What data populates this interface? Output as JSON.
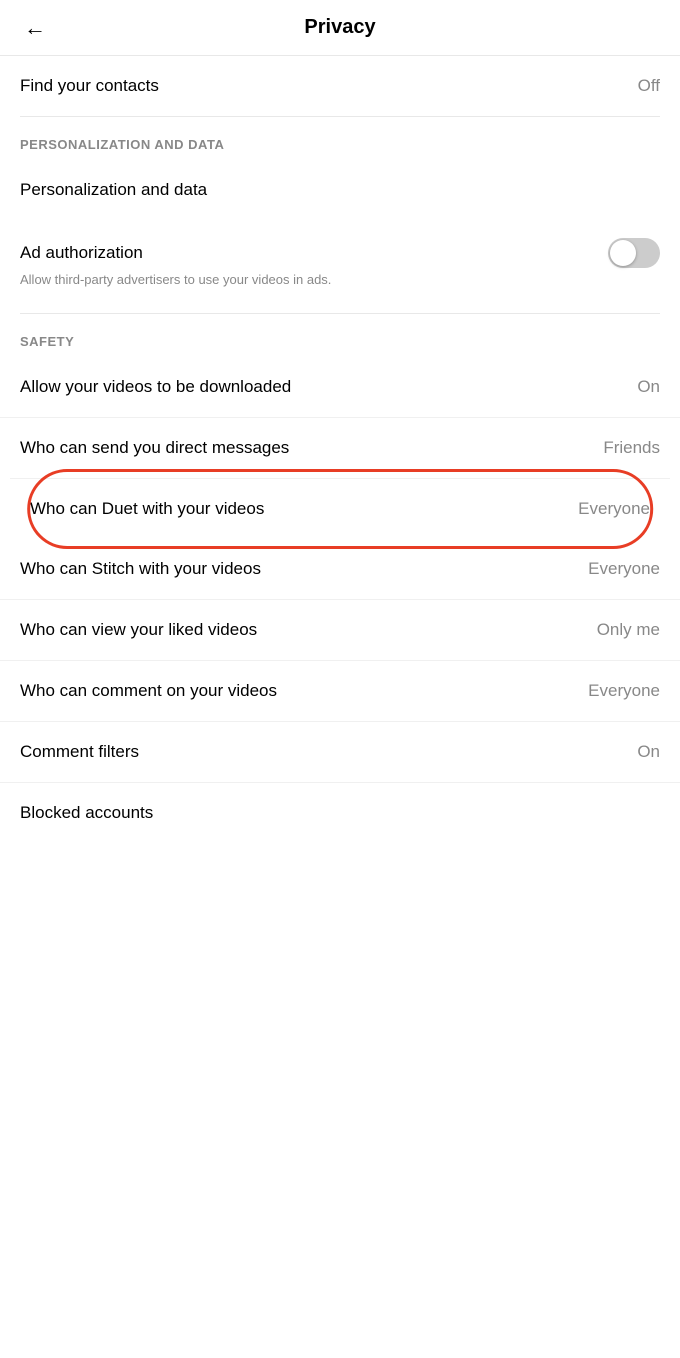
{
  "header": {
    "title": "Privacy",
    "back_label": "←"
  },
  "find_contacts": {
    "label": "Find your contacts",
    "value": "Off"
  },
  "sections": {
    "personalization": {
      "header": "PERSONALIZATION AND DATA",
      "items": [
        {
          "id": "personalization-data",
          "label": "Personalization and data",
          "value": "",
          "type": "navigate"
        },
        {
          "id": "ad-authorization",
          "label": "Ad authorization",
          "description": "Allow third-party advertisers to use your videos in ads.",
          "value": "off",
          "type": "toggle"
        }
      ]
    },
    "safety": {
      "header": "SAFETY",
      "items": [
        {
          "id": "allow-downloads",
          "label": "Allow your videos to be downloaded",
          "value": "On",
          "type": "value"
        },
        {
          "id": "direct-messages",
          "label": "Who can send you direct messages",
          "value": "Friends",
          "type": "value"
        },
        {
          "id": "duet",
          "label": "Who can Duet with your videos",
          "value": "Everyone",
          "type": "value",
          "highlighted": true
        },
        {
          "id": "stitch",
          "label": "Who can Stitch with your videos",
          "value": "Everyone",
          "type": "value"
        },
        {
          "id": "liked-videos",
          "label": "Who can view your liked videos",
          "value": "Only me",
          "type": "value"
        },
        {
          "id": "comment",
          "label": "Who can comment on your videos",
          "value": "Everyone",
          "type": "value"
        },
        {
          "id": "comment-filters",
          "label": "Comment filters",
          "value": "On",
          "type": "value"
        },
        {
          "id": "blocked-accounts",
          "label": "Blocked accounts",
          "value": "",
          "type": "navigate"
        }
      ]
    }
  }
}
